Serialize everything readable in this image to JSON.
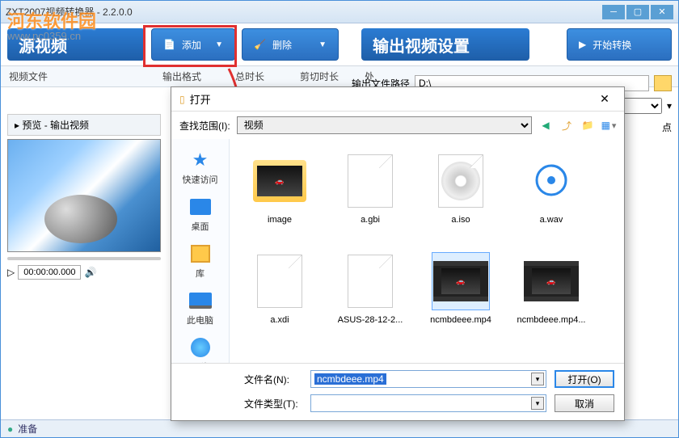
{
  "window": {
    "title": "ZXT2007视频转换器 - 2.2.0.0"
  },
  "watermark": {
    "text": "河东软件园",
    "url": "www.pc0359.cn"
  },
  "panels": {
    "source": "源视频",
    "output": "输出视频设置"
  },
  "buttons": {
    "add": "添加",
    "delete": "删除",
    "start": "开始转换"
  },
  "columns": {
    "c1": "视频文件",
    "c2": "输出格式",
    "c3": "总时长",
    "c4": "剪切时长",
    "c5": "处"
  },
  "output": {
    "path_label": "输出文件路径",
    "path_value": "D:\\",
    "point_label": "点"
  },
  "preview": {
    "title": "▸ 预览 - 输出视频",
    "time": "00:00:00.000"
  },
  "status": {
    "text": "准备"
  },
  "dialog": {
    "title": "打开",
    "look_in_label": "查找范围(I):",
    "look_in_value": "视频",
    "places": {
      "quick": "快速访问",
      "desktop": "桌面",
      "lib": "库",
      "pc": "此电脑",
      "net": "网络"
    },
    "files": [
      {
        "name": "image",
        "kind": "folder-car"
      },
      {
        "name": "a.gbi",
        "kind": "page"
      },
      {
        "name": "a.iso",
        "kind": "disc"
      },
      {
        "name": "a.wav",
        "kind": "wav"
      },
      {
        "name": "a.xdi",
        "kind": "page"
      },
      {
        "name": "ASUS-28-12-2...",
        "kind": "page"
      },
      {
        "name": "ncmbdeee.mp4",
        "kind": "video-car",
        "selected": true
      },
      {
        "name": "ncmbdeee.mp4...",
        "kind": "video-car"
      }
    ],
    "filename_label": "文件名(N):",
    "filename_value": "ncmbdeee.mp4",
    "filetype_label": "文件类型(T):",
    "filetype_value": "",
    "open_btn": "打开(O)",
    "cancel_btn": "取消"
  }
}
